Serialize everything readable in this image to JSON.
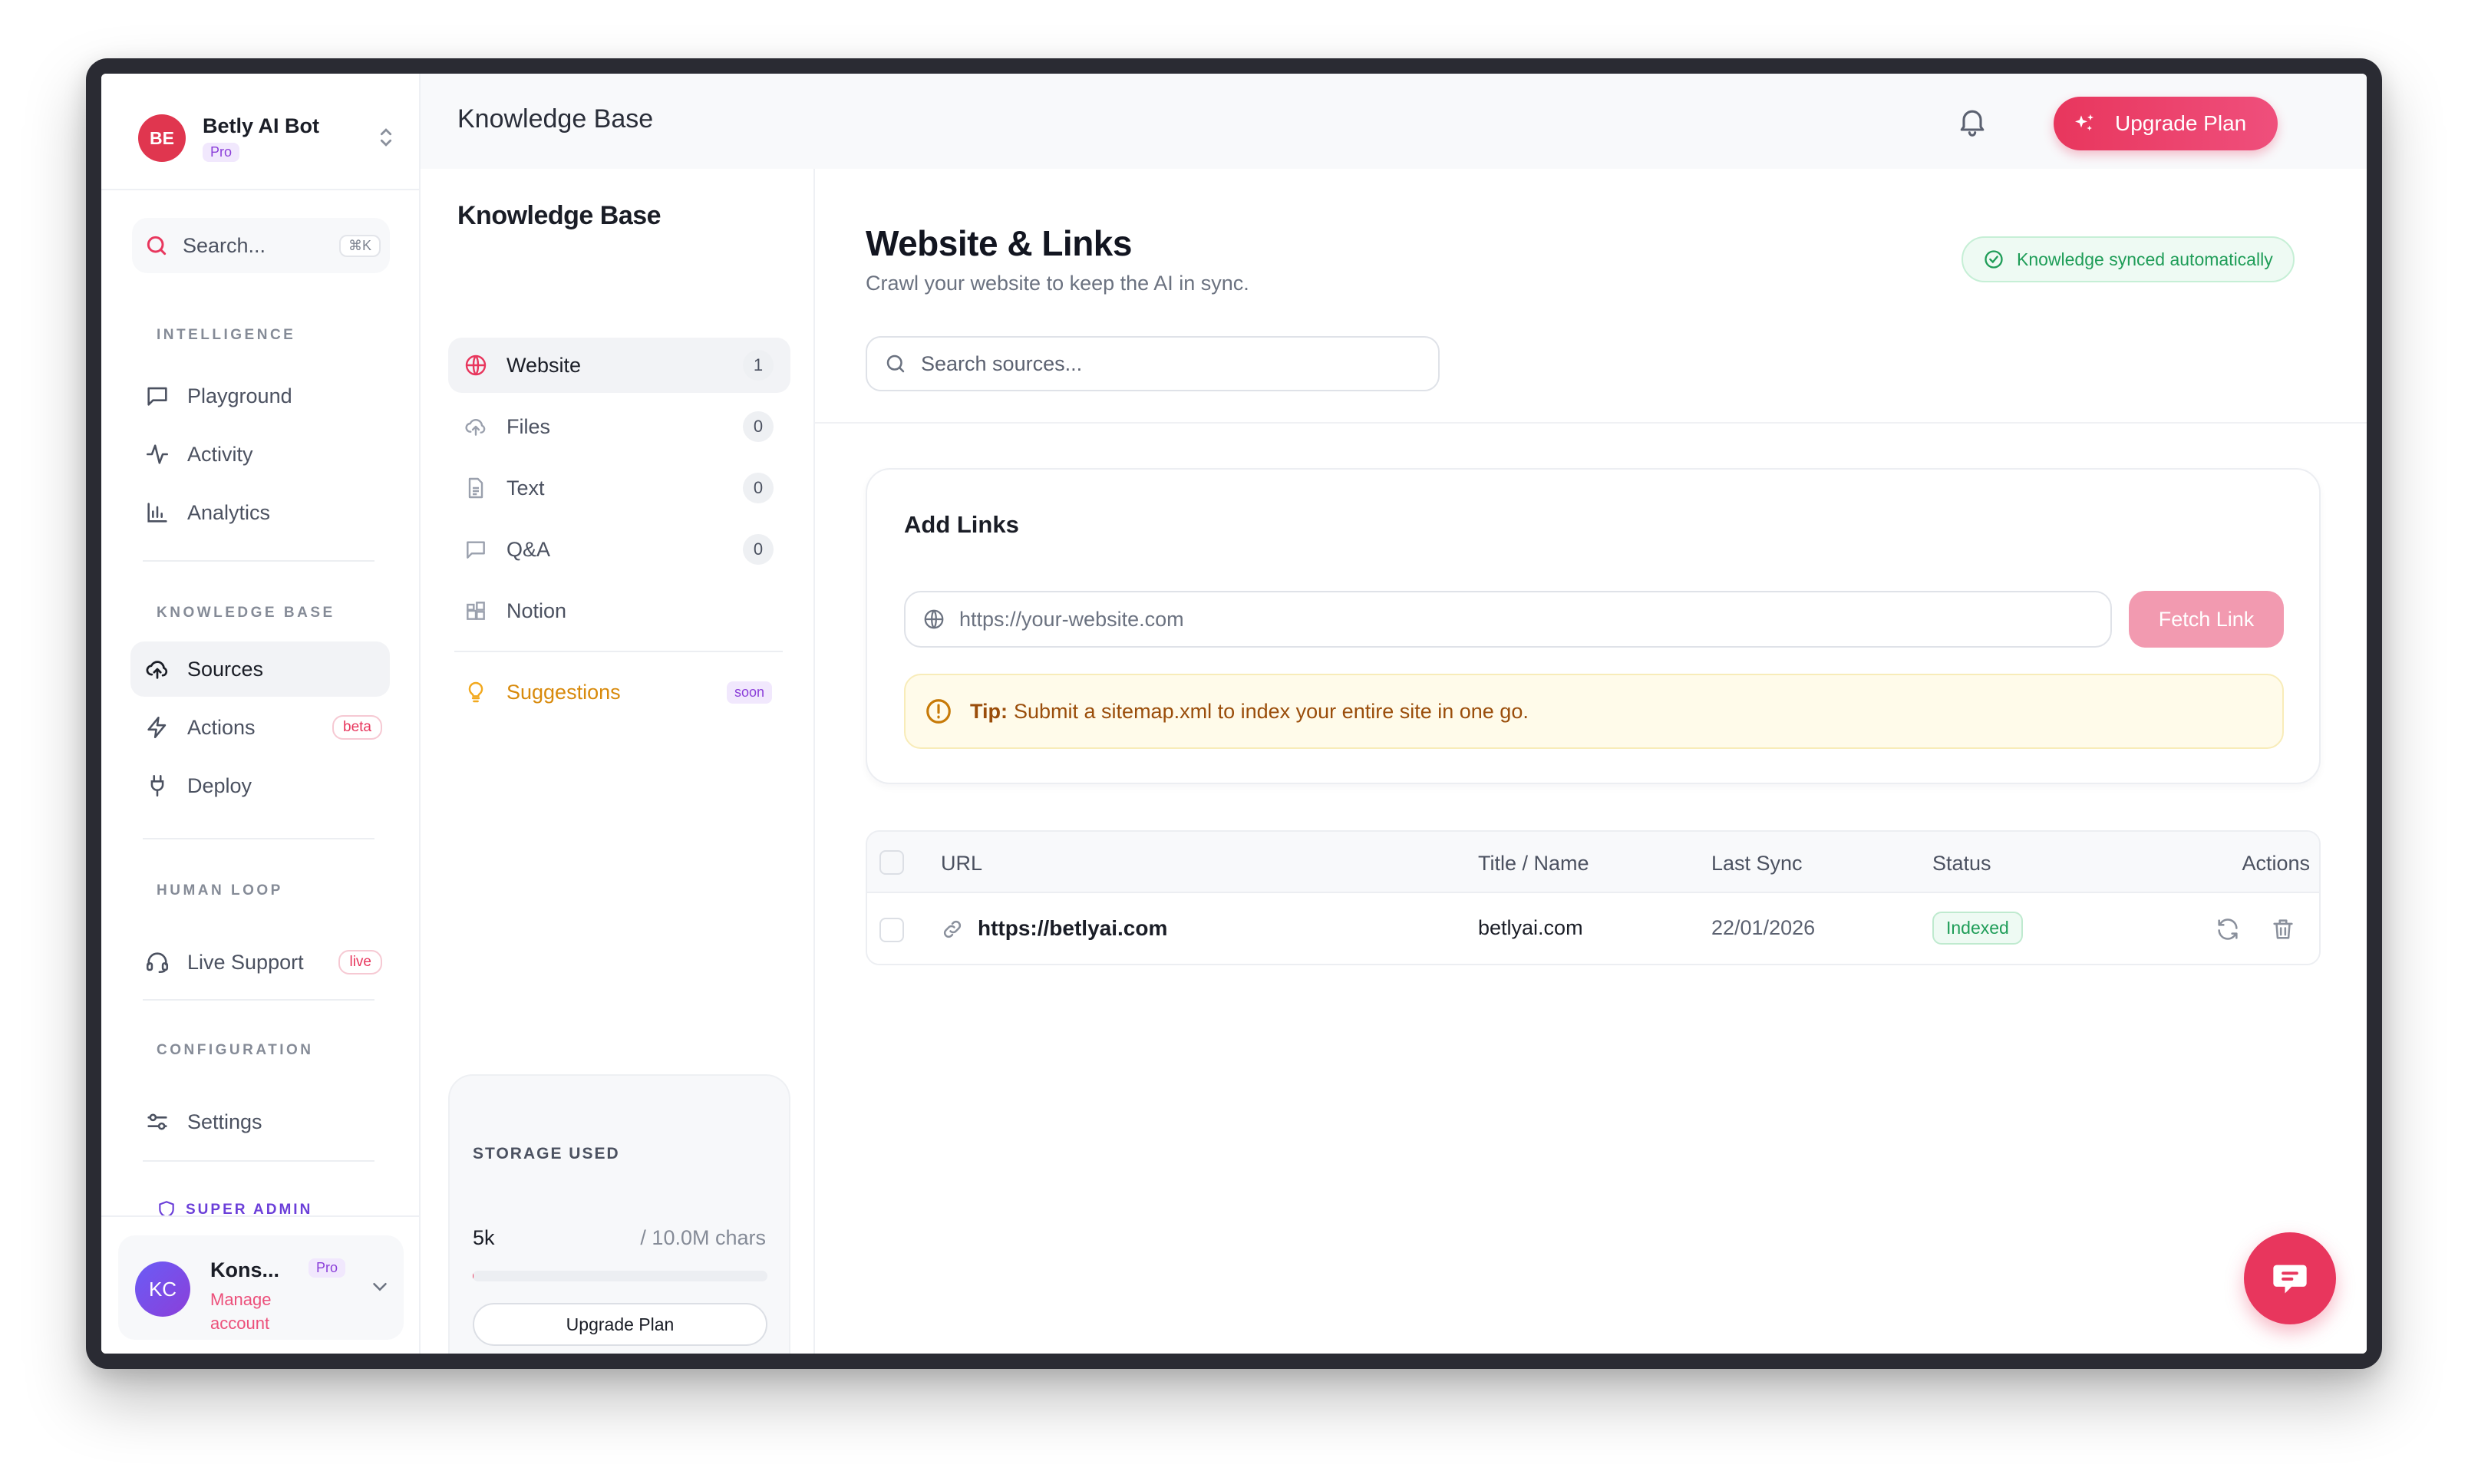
{
  "workspace": {
    "initials": "BE",
    "name": "Betly AI Bot",
    "plan": "Pro"
  },
  "search": {
    "placeholder": "Search...",
    "shortcut": "⌘K"
  },
  "sidebar": {
    "sections": {
      "intelligence": "INTELLIGENCE",
      "knowledge_base": "KNOWLEDGE BASE",
      "human_loop": "HUMAN LOOP",
      "configuration": "CONFIGURATION",
      "super_admin": "SUPER ADMIN"
    },
    "items": {
      "playground": "Playground",
      "activity": "Activity",
      "analytics": "Analytics",
      "sources": "Sources",
      "actions": "Actions",
      "actions_badge": "beta",
      "deploy": "Deploy",
      "live_support": "Live Support",
      "live_badge": "live",
      "settings": "Settings"
    }
  },
  "user": {
    "initials": "KC",
    "name": "Kons...",
    "plan": "Pro",
    "manage": "Manage account"
  },
  "header": {
    "title": "Knowledge Base",
    "upgrade": "Upgrade Plan"
  },
  "kb_nav": {
    "title": "Knowledge Base",
    "items": [
      {
        "label": "Website",
        "count": "1"
      },
      {
        "label": "Files",
        "count": "0"
      },
      {
        "label": "Text",
        "count": "0"
      },
      {
        "label": "Q&A",
        "count": "0"
      },
      {
        "label": "Notion"
      }
    ],
    "suggestions": "Suggestions",
    "suggestions_badge": "soon"
  },
  "storage": {
    "title": "STORAGE USED",
    "used": "5k",
    "limit": "/ 10.0M chars",
    "used_fraction": 0.0005,
    "upgrade": "Upgrade Plan"
  },
  "main": {
    "title": "Website & Links",
    "subtitle": "Crawl your website to keep the AI in sync.",
    "sync_badge": "Knowledge synced automatically",
    "search_placeholder": "Search sources..."
  },
  "add_links": {
    "title": "Add Links",
    "url_placeholder": "https://your-website.com",
    "fetch": "Fetch Link",
    "tip_label": "Tip:",
    "tip_text": "Submit a sitemap.xml to index your entire site in one go."
  },
  "table": {
    "columns": {
      "url": "URL",
      "title": "Title / Name",
      "last_sync": "Last Sync",
      "status": "Status",
      "actions": "Actions"
    },
    "rows": [
      {
        "url": "https://betlyai.com",
        "title": "betlyai.com",
        "last_sync": "22/01/2026",
        "status": "Indexed"
      }
    ]
  },
  "colors": {
    "accent": "#e8365d",
    "brand_pink": "#ec4f7a",
    "success": "#1f9d58",
    "warning_bg": "#fffbea",
    "pro_purple": "#8b3fd9"
  }
}
